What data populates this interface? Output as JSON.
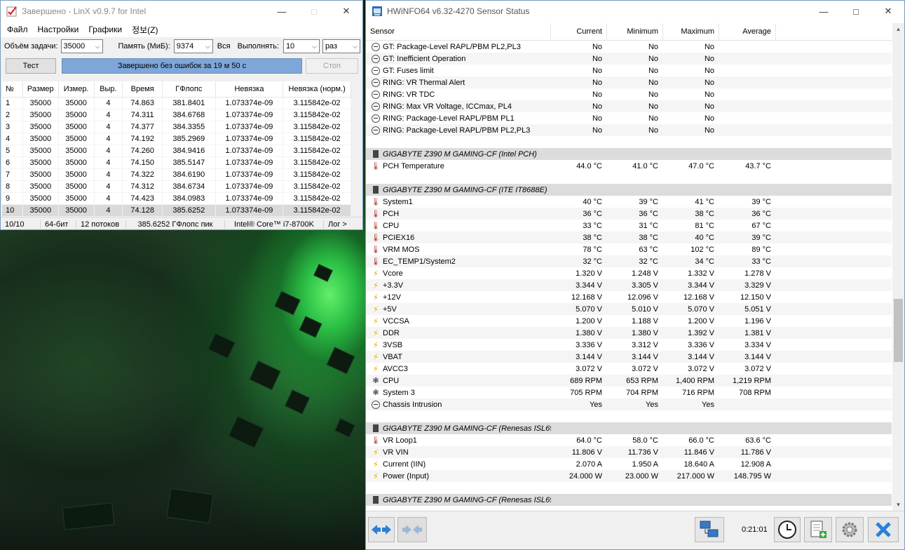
{
  "linx": {
    "title": "Завершено - LinX v0.9.7 for Intel",
    "menu": [
      "Файл",
      "Настройки",
      "Графики",
      "정보(Z)"
    ],
    "problem_size_label": "Объём задачи:",
    "problem_size_value": "35000",
    "memory_label": "Память (МиБ):",
    "memory_value": "9374",
    "all_label": "Вся",
    "run_label": "Выполнять:",
    "run_value": "10",
    "run_unit": "раз",
    "test_button": "Тест",
    "progress_text": "Завершено без ошибок за 19 м 50 с",
    "progress_fraction": 1.0,
    "stop_button": "Стоп",
    "columns": [
      "№",
      "Размер",
      "Измер.",
      "Выр.",
      "Время",
      "ГФлопс",
      "Невязка",
      "Невязка (норм.)"
    ],
    "rows": [
      [
        "1",
        "35000",
        "35000",
        "4",
        "74.863",
        "381.8401",
        "1.073374e-09",
        "3.115842e-02"
      ],
      [
        "2",
        "35000",
        "35000",
        "4",
        "74.311",
        "384.6768",
        "1.073374e-09",
        "3.115842e-02"
      ],
      [
        "3",
        "35000",
        "35000",
        "4",
        "74.377",
        "384.3355",
        "1.073374e-09",
        "3.115842e-02"
      ],
      [
        "4",
        "35000",
        "35000",
        "4",
        "74.192",
        "385.2969",
        "1.073374e-09",
        "3.115842e-02"
      ],
      [
        "5",
        "35000",
        "35000",
        "4",
        "74.260",
        "384.9416",
        "1.073374e-09",
        "3.115842e-02"
      ],
      [
        "6",
        "35000",
        "35000",
        "4",
        "74.150",
        "385.5147",
        "1.073374e-09",
        "3.115842e-02"
      ],
      [
        "7",
        "35000",
        "35000",
        "4",
        "74.322",
        "384.6190",
        "1.073374e-09",
        "3.115842e-02"
      ],
      [
        "8",
        "35000",
        "35000",
        "4",
        "74.312",
        "384.6734",
        "1.073374e-09",
        "3.115842e-02"
      ],
      [
        "9",
        "35000",
        "35000",
        "4",
        "74.423",
        "384.0983",
        "1.073374e-09",
        "3.115842e-02"
      ],
      [
        "10",
        "35000",
        "35000",
        "4",
        "74.128",
        "385.6252",
        "1.073374e-09",
        "3.115842e-02"
      ]
    ],
    "status": [
      "10/10",
      "64-бит",
      "12 потоков",
      "385.6252 ГФлопс пик",
      "Intel® Core™ i7-8700K",
      "Лог >"
    ]
  },
  "hw": {
    "title": "HWiNFO64 v6.32-4270 Sensor Status",
    "columns": [
      "Sensor",
      "Current",
      "Minimum",
      "Maximum",
      "Average"
    ],
    "clock": "0:21:01",
    "rows": [
      {
        "t": "no",
        "name": "GT: Package-Level RAPL/PBM PL2,PL3",
        "cur": "No",
        "min": "No",
        "max": "No",
        "avg": ""
      },
      {
        "t": "no",
        "name": "GT: Inefficient Operation",
        "cur": "No",
        "min": "No",
        "max": "No",
        "avg": ""
      },
      {
        "t": "no",
        "name": "GT: Fuses limit",
        "cur": "No",
        "min": "No",
        "max": "No",
        "avg": ""
      },
      {
        "t": "no",
        "name": "RING: VR Thermal Alert",
        "cur": "No",
        "min": "No",
        "max": "No",
        "avg": ""
      },
      {
        "t": "no",
        "name": "RING: VR TDC",
        "cur": "No",
        "min": "No",
        "max": "No",
        "avg": ""
      },
      {
        "t": "no",
        "name": "RING: Max VR Voltage, ICCmax, PL4",
        "cur": "No",
        "min": "No",
        "max": "No",
        "avg": ""
      },
      {
        "t": "no",
        "name": "RING: Package-Level RAPL/PBM PL1",
        "cur": "No",
        "min": "No",
        "max": "No",
        "avg": ""
      },
      {
        "t": "no",
        "name": "RING: Package-Level RAPL/PBM PL2,PL3",
        "cur": "No",
        "min": "No",
        "max": "No",
        "avg": ""
      },
      {
        "t": "blank",
        "name": "",
        "cur": "",
        "min": "",
        "max": "",
        "avg": ""
      },
      {
        "t": "grp",
        "name": "GIGABYTE Z390 M GAMING-CF (Intel PCH)",
        "cur": "",
        "min": "",
        "max": "",
        "avg": ""
      },
      {
        "t": "temp",
        "name": "PCH Temperature",
        "cur": "44.0 °C",
        "min": "41.0 °C",
        "max": "47.0 °C",
        "avg": "43.7 °C"
      },
      {
        "t": "blank",
        "name": "",
        "cur": "",
        "min": "",
        "max": "",
        "avg": ""
      },
      {
        "t": "grp",
        "name": "GIGABYTE Z390 M GAMING-CF (ITE IT8688E)",
        "cur": "",
        "min": "",
        "max": "",
        "avg": ""
      },
      {
        "t": "temp",
        "name": "System1",
        "cur": "40 °C",
        "min": "39 °C",
        "max": "41 °C",
        "avg": "39 °C"
      },
      {
        "t": "temp",
        "name": "PCH",
        "cur": "36 °C",
        "min": "36 °C",
        "max": "38 °C",
        "avg": "36 °C"
      },
      {
        "t": "temp",
        "name": "CPU",
        "cur": "33 °C",
        "min": "31 °C",
        "max": "81 °C",
        "avg": "67 °C"
      },
      {
        "t": "temp",
        "name": "PCIEX16",
        "cur": "38 °C",
        "min": "38 °C",
        "max": "40 °C",
        "avg": "39 °C"
      },
      {
        "t": "temp",
        "name": "VRM MOS",
        "cur": "78 °C",
        "min": "63 °C",
        "max": "102 °C",
        "avg": "89 °C"
      },
      {
        "t": "temp",
        "name": "EC_TEMP1/System2",
        "cur": "32 °C",
        "min": "32 °C",
        "max": "34 °C",
        "avg": "33 °C"
      },
      {
        "t": "volt",
        "name": "Vcore",
        "cur": "1.320 V",
        "min": "1.248 V",
        "max": "1.332 V",
        "avg": "1.278 V"
      },
      {
        "t": "volt",
        "name": "+3.3V",
        "cur": "3.344 V",
        "min": "3.305 V",
        "max": "3.344 V",
        "avg": "3.329 V"
      },
      {
        "t": "volt",
        "name": "+12V",
        "cur": "12.168 V",
        "min": "12.096 V",
        "max": "12.168 V",
        "avg": "12.150 V"
      },
      {
        "t": "volt",
        "name": "+5V",
        "cur": "5.070 V",
        "min": "5.010 V",
        "max": "5.070 V",
        "avg": "5.051 V"
      },
      {
        "t": "volt",
        "name": "VCCSA",
        "cur": "1.200 V",
        "min": "1.188 V",
        "max": "1.200 V",
        "avg": "1.196 V"
      },
      {
        "t": "volt",
        "name": "DDR",
        "cur": "1.380 V",
        "min": "1.380 V",
        "max": "1.392 V",
        "avg": "1.381 V"
      },
      {
        "t": "volt",
        "name": "3VSB",
        "cur": "3.336 V",
        "min": "3.312 V",
        "max": "3.336 V",
        "avg": "3.334 V"
      },
      {
        "t": "volt",
        "name": "VBAT",
        "cur": "3.144 V",
        "min": "3.144 V",
        "max": "3.144 V",
        "avg": "3.144 V"
      },
      {
        "t": "volt",
        "name": "AVCC3",
        "cur": "3.072 V",
        "min": "3.072 V",
        "max": "3.072 V",
        "avg": "3.072 V"
      },
      {
        "t": "fan",
        "name": "CPU",
        "cur": "689 RPM",
        "min": "653 RPM",
        "max": "1,400 RPM",
        "avg": "1,219 RPM"
      },
      {
        "t": "fan",
        "name": "System 3",
        "cur": "705 RPM",
        "min": "704 RPM",
        "max": "716 RPM",
        "avg": "708 RPM"
      },
      {
        "t": "no",
        "name": "Chassis Intrusion",
        "cur": "Yes",
        "min": "Yes",
        "max": "Yes",
        "avg": ""
      },
      {
        "t": "blank",
        "name": "",
        "cur": "",
        "min": "",
        "max": "",
        "avg": ""
      },
      {
        "t": "grp",
        "name": "GIGABYTE Z390 M GAMING-CF (Renesas ISL69...",
        "cur": "",
        "min": "",
        "max": "",
        "avg": ""
      },
      {
        "t": "temp",
        "name": "VR Loop1",
        "cur": "64.0 °C",
        "min": "58.0 °C",
        "max": "66.0 °C",
        "avg": "63.6 °C"
      },
      {
        "t": "volt",
        "name": "VR VIN",
        "cur": "11.806 V",
        "min": "11.736 V",
        "max": "11.846 V",
        "avg": "11.786 V"
      },
      {
        "t": "volt",
        "name": "Current (IIN)",
        "cur": "2.070 A",
        "min": "1.950 A",
        "max": "18.640 A",
        "avg": "12.908 A"
      },
      {
        "t": "volt",
        "name": "Power (Input)",
        "cur": "24.000 W",
        "min": "23.000 W",
        "max": "217.000 W",
        "avg": "148.795 W"
      },
      {
        "t": "blank",
        "name": "",
        "cur": "",
        "min": "",
        "max": "",
        "avg": ""
      },
      {
        "t": "grp",
        "name": "GIGABYTE Z390 M GAMING-CF (Renesas ISL69...",
        "cur": "",
        "min": "",
        "max": "",
        "avg": ""
      }
    ]
  }
}
